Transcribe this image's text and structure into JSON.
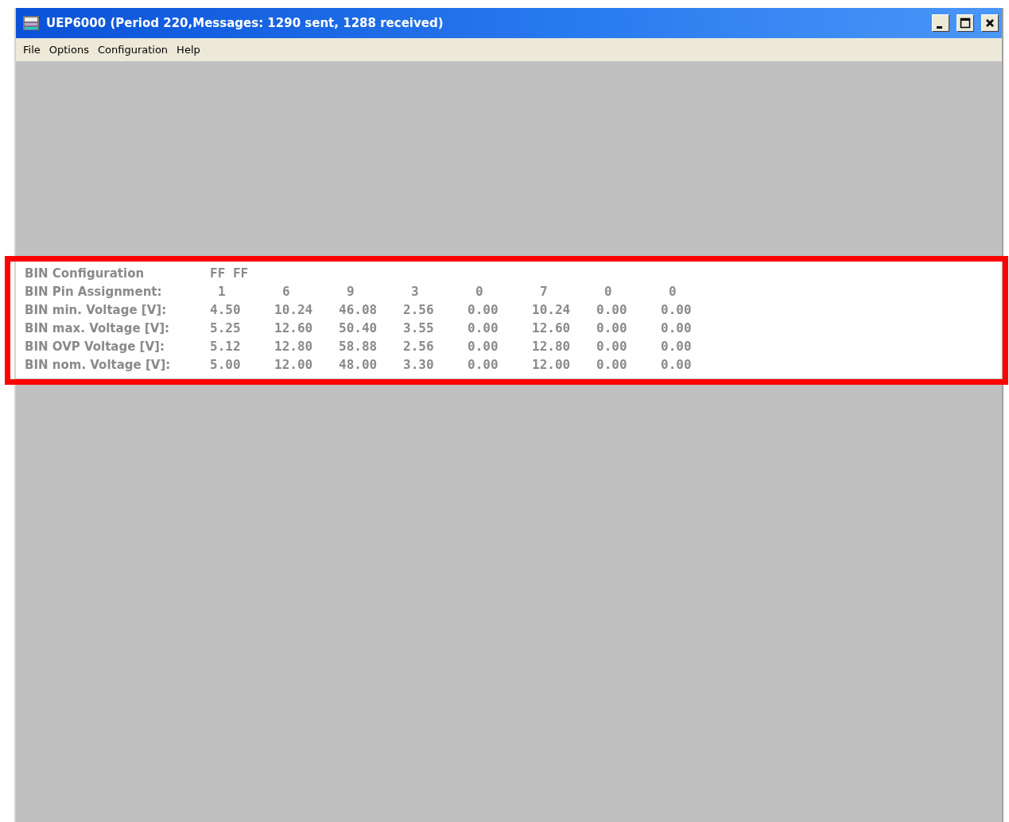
{
  "window": {
    "title": "UEP6000 (Period 220,Messages: 1290 sent, 1288 received)"
  },
  "menu": [
    "File",
    "Options",
    "Configuration",
    "Help"
  ],
  "table": {
    "rows": [
      {
        "kind": "config",
        "label": "BIN Configuration",
        "values": [
          "FF FF"
        ]
      },
      {
        "kind": "pins",
        "label": "BIN Pin Assignment:",
        "values": [
          "1",
          "6",
          "9",
          "3",
          "0",
          "7",
          "0",
          "0"
        ]
      },
      {
        "kind": "values",
        "label": "BIN min. Voltage [V]:",
        "values": [
          "4.50",
          "10.24",
          "46.08",
          "2.56",
          "0.00",
          "10.24",
          "0.00",
          "0.00"
        ]
      },
      {
        "kind": "values",
        "label": "BIN max. Voltage [V]:",
        "values": [
          "5.25",
          "12.60",
          "50.40",
          "3.55",
          "0.00",
          "12.60",
          "0.00",
          "0.00"
        ]
      },
      {
        "kind": "values",
        "label": "BIN OVP Voltage [V]:",
        "values": [
          "5.12",
          "12.80",
          "58.88",
          "2.56",
          "0.00",
          "12.80",
          "0.00",
          "0.00"
        ]
      },
      {
        "kind": "values",
        "label": "BIN nom. Voltage [V]:",
        "values": [
          "5.00",
          "12.00",
          "48.00",
          "3.30",
          "0.00",
          "12.00",
          "0.00",
          "0.00"
        ]
      }
    ]
  },
  "highlight": {
    "color": "#ff0000"
  }
}
